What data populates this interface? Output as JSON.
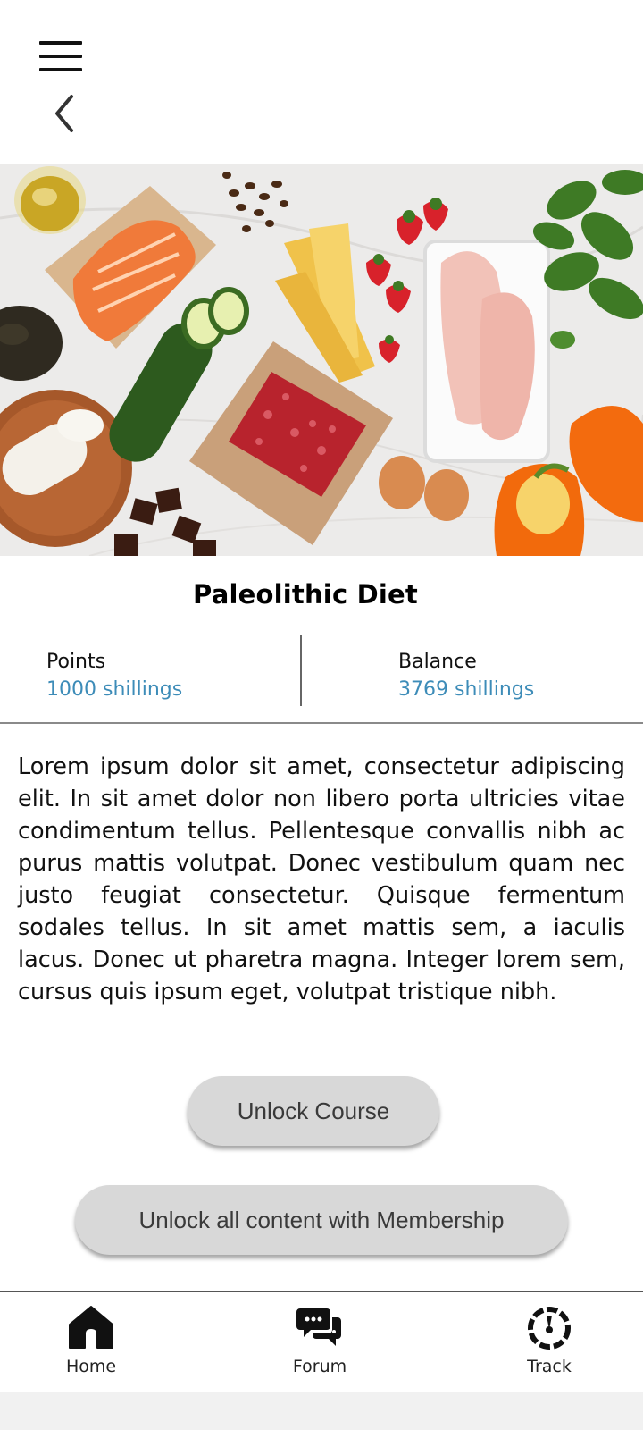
{
  "header": {
    "menu_icon": "hamburger-menu-icon",
    "back_icon": "chevron-left-icon"
  },
  "course": {
    "title": "Paleolithic Diet",
    "description": "Lorem ipsum dolor sit amet, consectetur adipiscing elit. In sit amet dolor non libero porta ultricies vitae condimentum tellus. Pellentesque convallis nibh ac purus mattis volutpat. Donec vestibulum quam nec justo feugiat consectetur. Quisque fermentum sodales tellus. In sit amet mattis sem, a iaculis lacus. Donec ut pharetra magna. Integer lorem sem, cursus quis ipsum eget, volutpat tristique nibh."
  },
  "stats": {
    "points_label": "Points",
    "points_value": "1000 shillings",
    "balance_label": "Balance",
    "balance_value": "3769 shillings"
  },
  "actions": {
    "unlock_course": "Unlock Course",
    "unlock_membership": "Unlock all content with Membership"
  },
  "nav": {
    "home": "Home",
    "forum": "Forum",
    "track": "Track"
  },
  "colors": {
    "accent_value": "#3d8cb8",
    "button_bg": "#d8d8d8",
    "button_text": "#3a3a3a"
  }
}
